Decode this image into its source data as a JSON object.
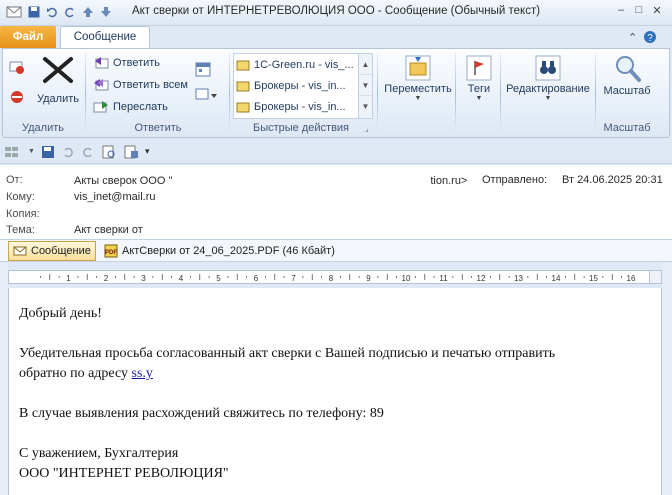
{
  "window": {
    "title": "Акт сверки от ИНТЕРНЕТРЕВОЛЮЦИЯ ООО  -  Сообщение (Обычный текст)"
  },
  "tabs": {
    "file": "Файл",
    "message": "Сообщение"
  },
  "ribbon": {
    "delete_group": {
      "label": "Удалить",
      "delete_button": "Удалить"
    },
    "respond_group": {
      "label": "Ответить",
      "reply": "Ответить",
      "reply_all": "Ответить всем",
      "forward": "Переслать"
    },
    "quick_steps": {
      "label": "Быстрые действия",
      "items": [
        "1C-Green.ru - vis_...",
        "Брокеры - vis_in...",
        "Брокеры - vis_in..."
      ]
    },
    "move": {
      "label": "Переместить"
    },
    "tags": {
      "label": "Теги"
    },
    "editing": {
      "label": "Редактирование"
    },
    "zoom": {
      "label": "Масштаб",
      "group_label": "Масштаб"
    }
  },
  "header": {
    "from_label": "От:",
    "from_value": "Акты сверок ООО \"",
    "from_tail": "tion.ru>",
    "to_label": "Кому:",
    "to_value": "vis_inet@mail.ru",
    "cc_label": "Копия:",
    "subject_label": "Тема:",
    "subject_value": "Акт сверки от",
    "sent_label": "Отправлено:",
    "sent_value": "Вт 24.06.2025 20:31"
  },
  "attachments": {
    "message_tab": "Сообщение",
    "file": "АктСверки от 24_06_2025.PDF (46 Кбайт)"
  },
  "message": {
    "greeting": "Добрый день!",
    "line1": "Убедительная просьба согласованный акт сверки с Вашей подписью и печатью отправить",
    "line2_prefix": "обратно по адресу ",
    "line2_link": "ss.y",
    "line3": "В случае выявления расхождений свяжитесь по телефону: 89",
    "sign1": "С уважением, Бухгалтерия",
    "sign2": "ООО \"ИНТЕРНЕТ РЕВОЛЮЦИЯ\""
  },
  "ruler": {
    "labels": [
      "1",
      "1",
      "2",
      "3",
      "4",
      "5",
      "6",
      "7",
      "8",
      "9",
      "10",
      "11",
      "12",
      "13",
      "14",
      "15",
      "16"
    ]
  },
  "colors": {
    "file_tab": "#e8901a",
    "ribbon_bg": "#dfe8f5",
    "link": "#1a1aa8"
  }
}
